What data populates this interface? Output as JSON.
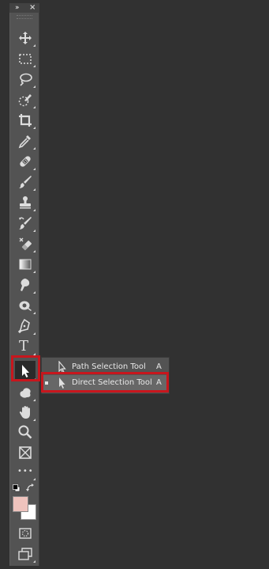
{
  "toolbar": {
    "collapse_glyph": "››",
    "close_glyph": "×",
    "tools": [
      {
        "name": "move-tool",
        "icon": "move-icon"
      },
      {
        "name": "marquee-tool",
        "icon": "rect-marquee-icon"
      },
      {
        "name": "lasso-tool",
        "icon": "lasso-icon"
      },
      {
        "name": "quick-selection-tool",
        "icon": "quick-selection-icon"
      },
      {
        "name": "crop-tool",
        "icon": "crop-icon"
      },
      {
        "name": "eyedropper-tool",
        "icon": "eyedropper-icon"
      },
      {
        "name": "healing-brush-tool",
        "icon": "bandage-icon"
      },
      {
        "name": "brush-tool",
        "icon": "brush-icon"
      },
      {
        "name": "clone-stamp-tool",
        "icon": "stamp-icon"
      },
      {
        "name": "history-brush-tool",
        "icon": "history-brush-icon"
      },
      {
        "name": "eraser-tool",
        "icon": "eraser-icon"
      },
      {
        "name": "gradient-tool",
        "icon": "gradient-icon"
      },
      {
        "name": "blur-tool",
        "icon": "blur-icon"
      },
      {
        "name": "dodge-tool",
        "icon": "dodge-icon"
      },
      {
        "name": "pen-tool",
        "icon": "pen-icon"
      },
      {
        "name": "type-tool",
        "icon": "type-icon"
      },
      {
        "name": "path-selection-tool",
        "icon": "arrow-cursor-icon"
      },
      {
        "name": "custom-shape-tool",
        "icon": "shape-icon"
      },
      {
        "name": "hand-tool",
        "icon": "hand-icon"
      },
      {
        "name": "zoom-tool",
        "icon": "zoom-icon"
      },
      {
        "name": "frame-tool",
        "icon": "frame-icon"
      },
      {
        "name": "edit-toolbar",
        "icon": "ellipsis-icon"
      }
    ],
    "type_glyph": "T",
    "more_glyph": "•••"
  },
  "colors": {
    "foreground": "#efc3bd",
    "background": "#ffffff",
    "highlight": "#c8161d"
  },
  "flyout": {
    "items": [
      {
        "label": "Path Selection Tool",
        "shortcut": "A",
        "selected": false
      },
      {
        "label": "Direct Selection Tool",
        "shortcut": "A",
        "selected": true
      }
    ]
  }
}
